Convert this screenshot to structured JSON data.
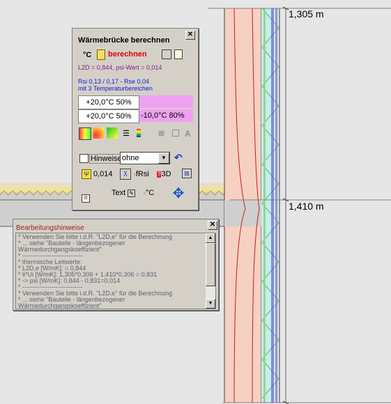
{
  "drawing": {
    "dimension_top": "1,305 m",
    "dimension_bottom": "1,410 m",
    "colors": {
      "wall": "#f6d0c0",
      "insulation": "#a0e0e8",
      "hatch": "#40c060",
      "purple_layer": "#8080e0"
    }
  },
  "calc_dialog": {
    "title": "Wärmebrücke berechnen",
    "unit_label": "°C",
    "calc_label": "berechnen",
    "result_line": "L2D = 0,844, psi-Wert = 0,014",
    "rsi_line": "Rsi 0,13 / 0,17 - Rse 0,04",
    "temp_ranges_line": "mit 3 Temperaturbereichen",
    "temp_cell_1": "+20,0°C 50%",
    "temp_cell_2": "+20,0°C 50%",
    "temp_cell_3": "-10,0°C 80%",
    "hints_checkbox_label": "Hinweise",
    "combo_value": "ohne",
    "psi_value": "0,014",
    "frsi_label": "fRsi",
    "three_d_label": "3D",
    "text_label": "Text",
    "celsius_label": "°C",
    "letter_a": "A",
    "icons": [
      "calculator-icon",
      "print-icon",
      "copy-icon",
      "color-scale-icon",
      "isotherm-icon",
      "heatflow-icon",
      "list-icon",
      "legend-icon",
      "grid-icon",
      "undo-icon",
      "psi-icon",
      "export-icon",
      "chart-icon",
      "move-icon",
      "help-3d-icon"
    ]
  },
  "hints_dialog": {
    "title": "Bearbeitungshinweise",
    "lines": [
      "* Verwenden Sie bitte i.d.R. \"L2D,e\" für die Berechnung",
      "* ... siehe \"Bauteile - längenbezogener",
      "Wärmedurchgangskoeffizient\"",
      "* -----------------------------",
      "* thermische Leitwerte:",
      "* L2D,e [W/mK]: = 0,844",
      "* li*Ui [W/mK]: 1,305*0,306 + 1,410*0,306 = 0,831",
      "* -> psi [W/mK]: 0,844 - 0,831=0,014",
      "* -----------------------------",
      "* Verwenden Sie bitte i.d.R. \"L2D,e\" für die Berechnung",
      "* ... siehe \"Bauteile - längenbezogener",
      "Wärmedurchgangskoeffizient\""
    ]
  }
}
